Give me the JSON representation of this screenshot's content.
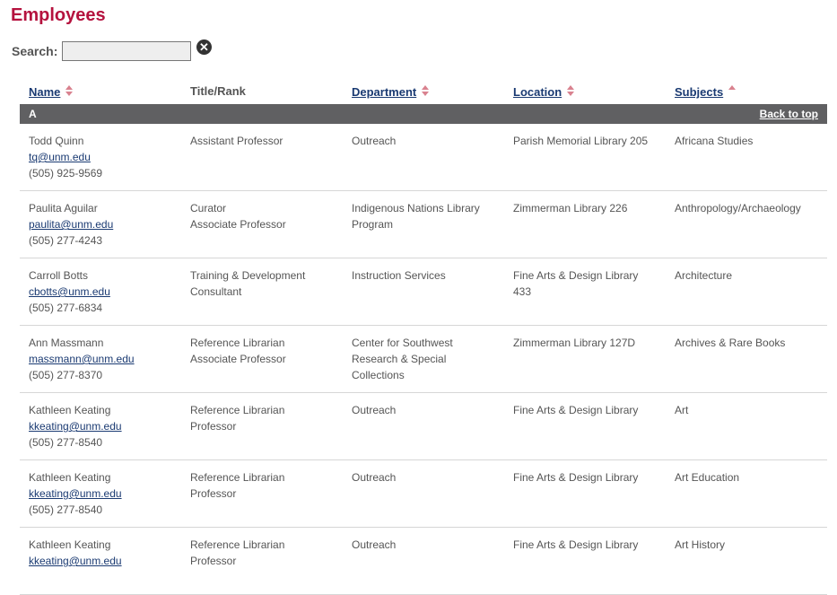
{
  "page": {
    "title": "Employees"
  },
  "search": {
    "label": "Search:",
    "value": "",
    "placeholder": ""
  },
  "columns": {
    "name": "Name",
    "title_rank": "Title/Rank",
    "department": "Department",
    "location": "Location",
    "subjects": "Subjects"
  },
  "group": {
    "letter": "A",
    "back_to_top": "Back to top"
  },
  "rows": [
    {
      "name": "Todd Quinn",
      "email": "tq@unm.edu",
      "phone": "(505) 925-9569",
      "title_lines": [
        "Assistant Professor"
      ],
      "dept_lines": [
        "Outreach"
      ],
      "loc_lines": [
        "Parish Memorial Library 205"
      ],
      "subject": "Africana Studies"
    },
    {
      "name": "Paulita Aguilar",
      "email": "paulita@unm.edu",
      "phone": "(505) 277-4243",
      "title_lines": [
        "Curator",
        "Associate Professor"
      ],
      "dept_lines": [
        "Indigenous Nations Library",
        "Program"
      ],
      "loc_lines": [
        "Zimmerman Library 226"
      ],
      "subject": "Anthropology/Archaeology"
    },
    {
      "name": "Carroll Botts",
      "email": "cbotts@unm.edu",
      "phone": "(505) 277-6834",
      "title_lines": [
        "Training & Development",
        "Consultant"
      ],
      "dept_lines": [
        "Instruction Services"
      ],
      "loc_lines": [
        "Fine Arts & Design Library",
        "433"
      ],
      "subject": "Architecture"
    },
    {
      "name": "Ann Massmann",
      "email": "massmann@unm.edu",
      "phone": "(505) 277-8370",
      "title_lines": [
        "Reference Librarian",
        "Associate Professor"
      ],
      "dept_lines": [
        "Center for Southwest",
        "Research & Special",
        "Collections"
      ],
      "loc_lines": [
        "Zimmerman Library 127D"
      ],
      "subject": "Archives & Rare Books"
    },
    {
      "name": "Kathleen Keating",
      "email": "kkeating@unm.edu",
      "phone": "(505) 277-8540",
      "title_lines": [
        "Reference Librarian",
        "Professor"
      ],
      "dept_lines": [
        "Outreach"
      ],
      "loc_lines": [
        "Fine Arts & Design Library"
      ],
      "subject": "Art"
    },
    {
      "name": "Kathleen Keating",
      "email": "kkeating@unm.edu",
      "phone": "(505) 277-8540",
      "title_lines": [
        "Reference Librarian",
        "Professor"
      ],
      "dept_lines": [
        "Outreach"
      ],
      "loc_lines": [
        "Fine Arts & Design Library"
      ],
      "subject": "Art Education"
    },
    {
      "name": "Kathleen Keating",
      "email": "kkeating@unm.edu",
      "phone": "",
      "title_lines": [
        "Reference Librarian",
        "Professor"
      ],
      "dept_lines": [
        "Outreach"
      ],
      "loc_lines": [
        "Fine Arts & Design Library"
      ],
      "subject": "Art History"
    }
  ]
}
